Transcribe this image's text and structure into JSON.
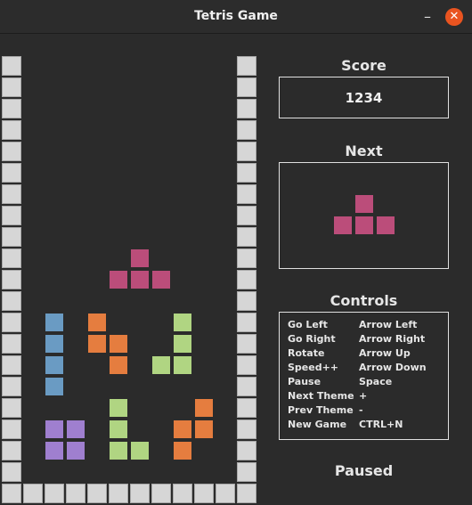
{
  "window": {
    "title": "Tetris Game",
    "minimize_glyph": "–",
    "close_glyph": "✕"
  },
  "score": {
    "label": "Score",
    "value": "1234"
  },
  "next": {
    "label": "Next",
    "piece": "T",
    "color": "#bb4d7a"
  },
  "controls": {
    "label": "Controls",
    "rows": [
      {
        "action": "Go Left",
        "key": "Arrow Left"
      },
      {
        "action": "Go Right",
        "key": "Arrow Right"
      },
      {
        "action": "Rotate",
        "key": "Arrow Up"
      },
      {
        "action": "Speed++",
        "key": "Arrow Down"
      },
      {
        "action": "Pause",
        "key": "Space"
      },
      {
        "action": "Next Theme",
        "key": "+"
      },
      {
        "action": "Prev Theme",
        "key": "-"
      },
      {
        "action": "New Game",
        "key": "CTRL+N"
      }
    ]
  },
  "status": "Paused",
  "colors": {
    "wall": "#d6d6d6",
    "pink": "#bb4d7a",
    "blue": "#6a9bc3",
    "orange": "#e57d3f",
    "green": "#b0d582",
    "purple": "#9f7fcf"
  },
  "board": {
    "columns": 10,
    "rows": 20,
    "cells": [
      {
        "col": 5,
        "row": 9,
        "color": "pink"
      },
      {
        "col": 4,
        "row": 10,
        "color": "pink"
      },
      {
        "col": 5,
        "row": 10,
        "color": "pink"
      },
      {
        "col": 6,
        "row": 10,
        "color": "pink"
      },
      {
        "col": 1,
        "row": 12,
        "color": "blue"
      },
      {
        "col": 1,
        "row": 13,
        "color": "blue"
      },
      {
        "col": 1,
        "row": 14,
        "color": "blue"
      },
      {
        "col": 1,
        "row": 15,
        "color": "blue"
      },
      {
        "col": 3,
        "row": 12,
        "color": "orange"
      },
      {
        "col": 3,
        "row": 13,
        "color": "orange"
      },
      {
        "col": 4,
        "row": 13,
        "color": "orange"
      },
      {
        "col": 4,
        "row": 14,
        "color": "orange"
      },
      {
        "col": 7,
        "row": 12,
        "color": "green"
      },
      {
        "col": 7,
        "row": 13,
        "color": "green"
      },
      {
        "col": 6,
        "row": 14,
        "color": "green"
      },
      {
        "col": 7,
        "row": 14,
        "color": "green"
      },
      {
        "col": 4,
        "row": 16,
        "color": "green"
      },
      {
        "col": 4,
        "row": 17,
        "color": "green"
      },
      {
        "col": 4,
        "row": 18,
        "color": "green"
      },
      {
        "col": 5,
        "row": 18,
        "color": "green"
      },
      {
        "col": 8,
        "row": 16,
        "color": "orange"
      },
      {
        "col": 7,
        "row": 17,
        "color": "orange"
      },
      {
        "col": 8,
        "row": 17,
        "color": "orange"
      },
      {
        "col": 7,
        "row": 18,
        "color": "orange"
      },
      {
        "col": 1,
        "row": 17,
        "color": "purple"
      },
      {
        "col": 2,
        "row": 17,
        "color": "purple"
      },
      {
        "col": 1,
        "row": 18,
        "color": "purple"
      },
      {
        "col": 2,
        "row": 18,
        "color": "purple"
      }
    ]
  }
}
